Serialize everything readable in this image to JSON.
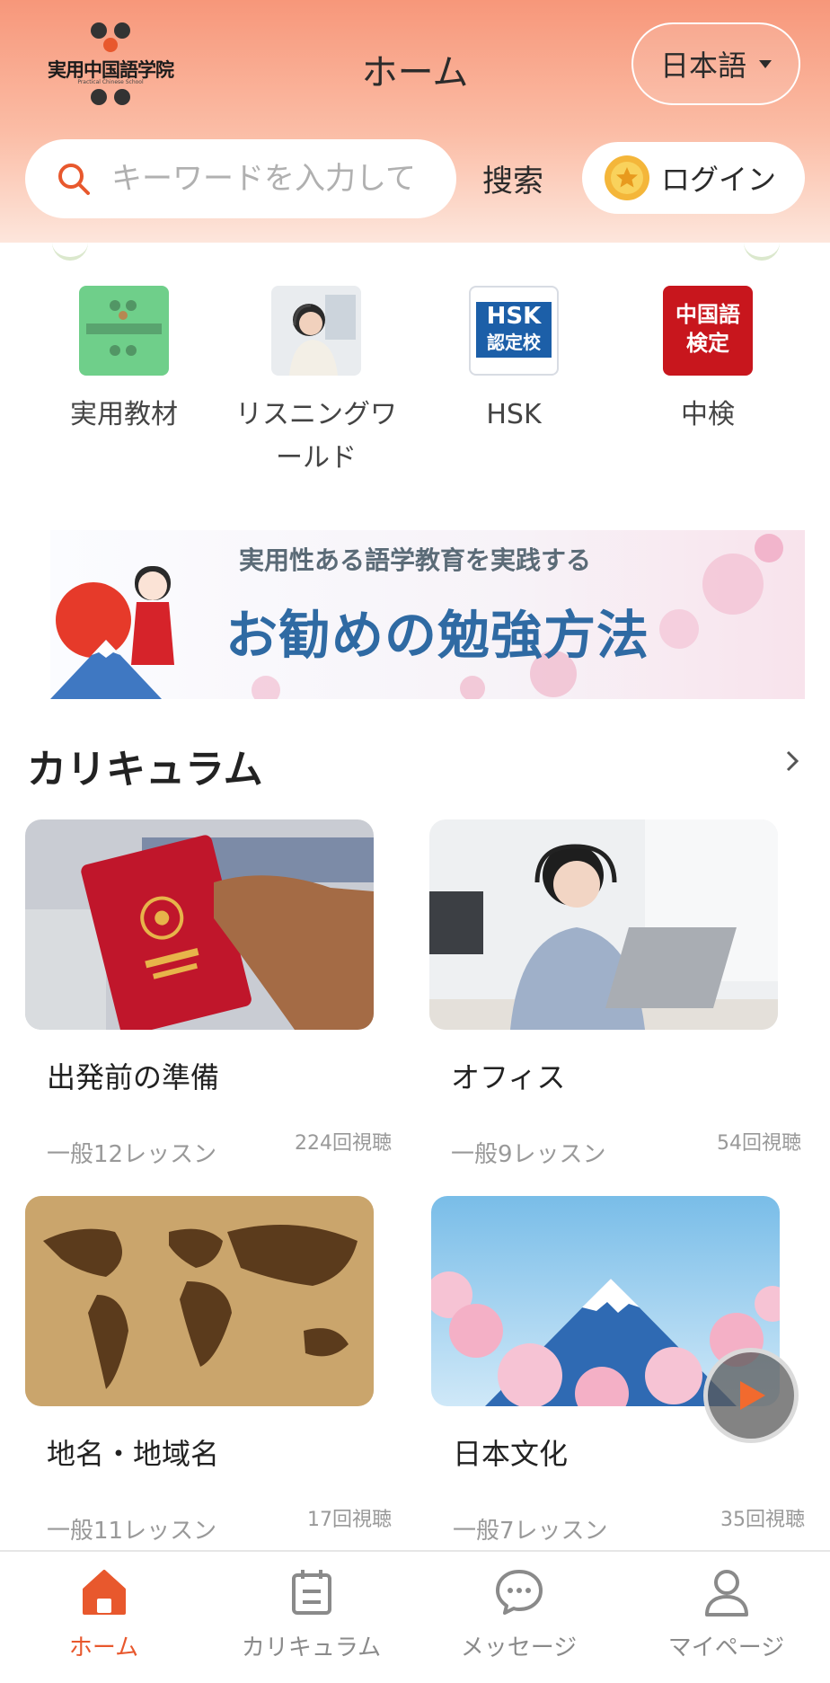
{
  "header": {
    "logo_text": "実用中国語学院",
    "logo_subtitle": "Practical Chinese School",
    "page_title": "ホーム",
    "language": "日本語",
    "search_placeholder": "キーワードを入力して",
    "search_button": "搜索",
    "login_label": "ログイン"
  },
  "quick_menu": [
    {
      "label": "実用教材",
      "icon": "practical-materials-icon"
    },
    {
      "label": "リスニングワールド",
      "icon": "listening-world-icon"
    },
    {
      "label": "HSK",
      "icon": "hsk-icon",
      "badge_text": "HSK",
      "badge_sub": "認定校"
    },
    {
      "label": "中検",
      "icon": "chuken-icon",
      "badge_text": "中国語\n検定"
    }
  ],
  "banner": {
    "subtitle": "実用性ある語学教育を実践する",
    "title": "お勧めの勉強方法"
  },
  "curriculum": {
    "title": "カリキュラム",
    "cards": [
      {
        "title": "出発前の準備",
        "lessons": "一般12レッスン",
        "views": "224回視聴",
        "image": "passport-photo"
      },
      {
        "title": "オフィス",
        "lessons": "一般9レッスン",
        "views": "54回視聴",
        "image": "office-photo"
      },
      {
        "title": "地名・地域名",
        "lessons": "一般11レッスン",
        "views": "17回視聴",
        "image": "world-map-photo"
      },
      {
        "title": "日本文化",
        "lessons": "一般7レッスン",
        "views": "35回視聴",
        "image": "mount-fuji-photo"
      }
    ]
  },
  "tabbar": {
    "active": "home",
    "tabs": [
      {
        "label": "ホーム",
        "icon": "home-icon"
      },
      {
        "label": "カリキュラム",
        "icon": "calendar-icon"
      },
      {
        "label": "メッセージ",
        "icon": "chat-icon"
      },
      {
        "label": "マイページ",
        "icon": "user-icon"
      }
    ]
  },
  "colors": {
    "accent": "#e8582d",
    "header_gradient_top": "#f7977a",
    "header_gradient_bottom": "#fde6dc"
  }
}
